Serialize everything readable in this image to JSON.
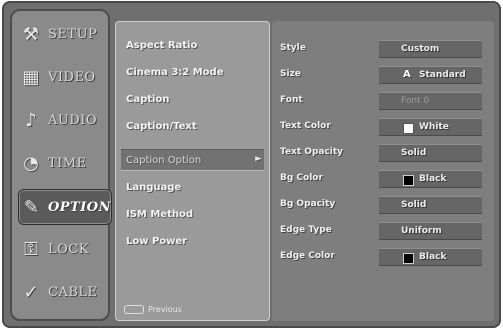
{
  "tabs": [
    {
      "icon": "setup-icon",
      "glyph": "⚒",
      "label": "SETUP"
    },
    {
      "icon": "video-icon",
      "glyph": "▦",
      "label": "VIDEO"
    },
    {
      "icon": "audio-icon",
      "glyph": "♪",
      "label": "AUDIO"
    },
    {
      "icon": "time-icon",
      "glyph": "◔",
      "label": "TIME"
    },
    {
      "icon": "option-icon",
      "glyph": "✎",
      "label": "OPTION"
    },
    {
      "icon": "lock-icon",
      "glyph": "⚿",
      "label": "LOCK"
    },
    {
      "icon": "cable-icon",
      "glyph": "✓",
      "label": "CABLE"
    }
  ],
  "active_tab": "OPTION",
  "menu": {
    "items": [
      "Aspect Ratio",
      "Cinema 3:2 Mode",
      "Caption",
      "Caption/Text",
      "Caption Option",
      "Language",
      "ISM Method",
      "Low Power"
    ],
    "selected": "Caption Option",
    "arrow": "►",
    "previous_label": "Previous"
  },
  "options": [
    {
      "label": "Style",
      "value": "Custom"
    },
    {
      "label": "Size",
      "value": "Standard",
      "glyph": "A"
    },
    {
      "label": "Font",
      "value": "Font 0",
      "dim": true
    },
    {
      "label": "Text Color",
      "value": "White",
      "swatch": "#ffffff"
    },
    {
      "label": "Text Opacity",
      "value": "Solid"
    },
    {
      "label": "Bg Color",
      "value": "Black",
      "swatch": "#000000"
    },
    {
      "label": "Bg Opacity",
      "value": "Solid"
    },
    {
      "label": "Edge Type",
      "value": "Uniform"
    },
    {
      "label": "Edge Color",
      "value": "Black",
      "swatch": "#000000"
    }
  ],
  "colors": {
    "screen_bg": "#6f6f6f",
    "menu_bg": "#9a9a9a",
    "options_bg": "#7e7e7e",
    "value_bg": "#666666"
  }
}
